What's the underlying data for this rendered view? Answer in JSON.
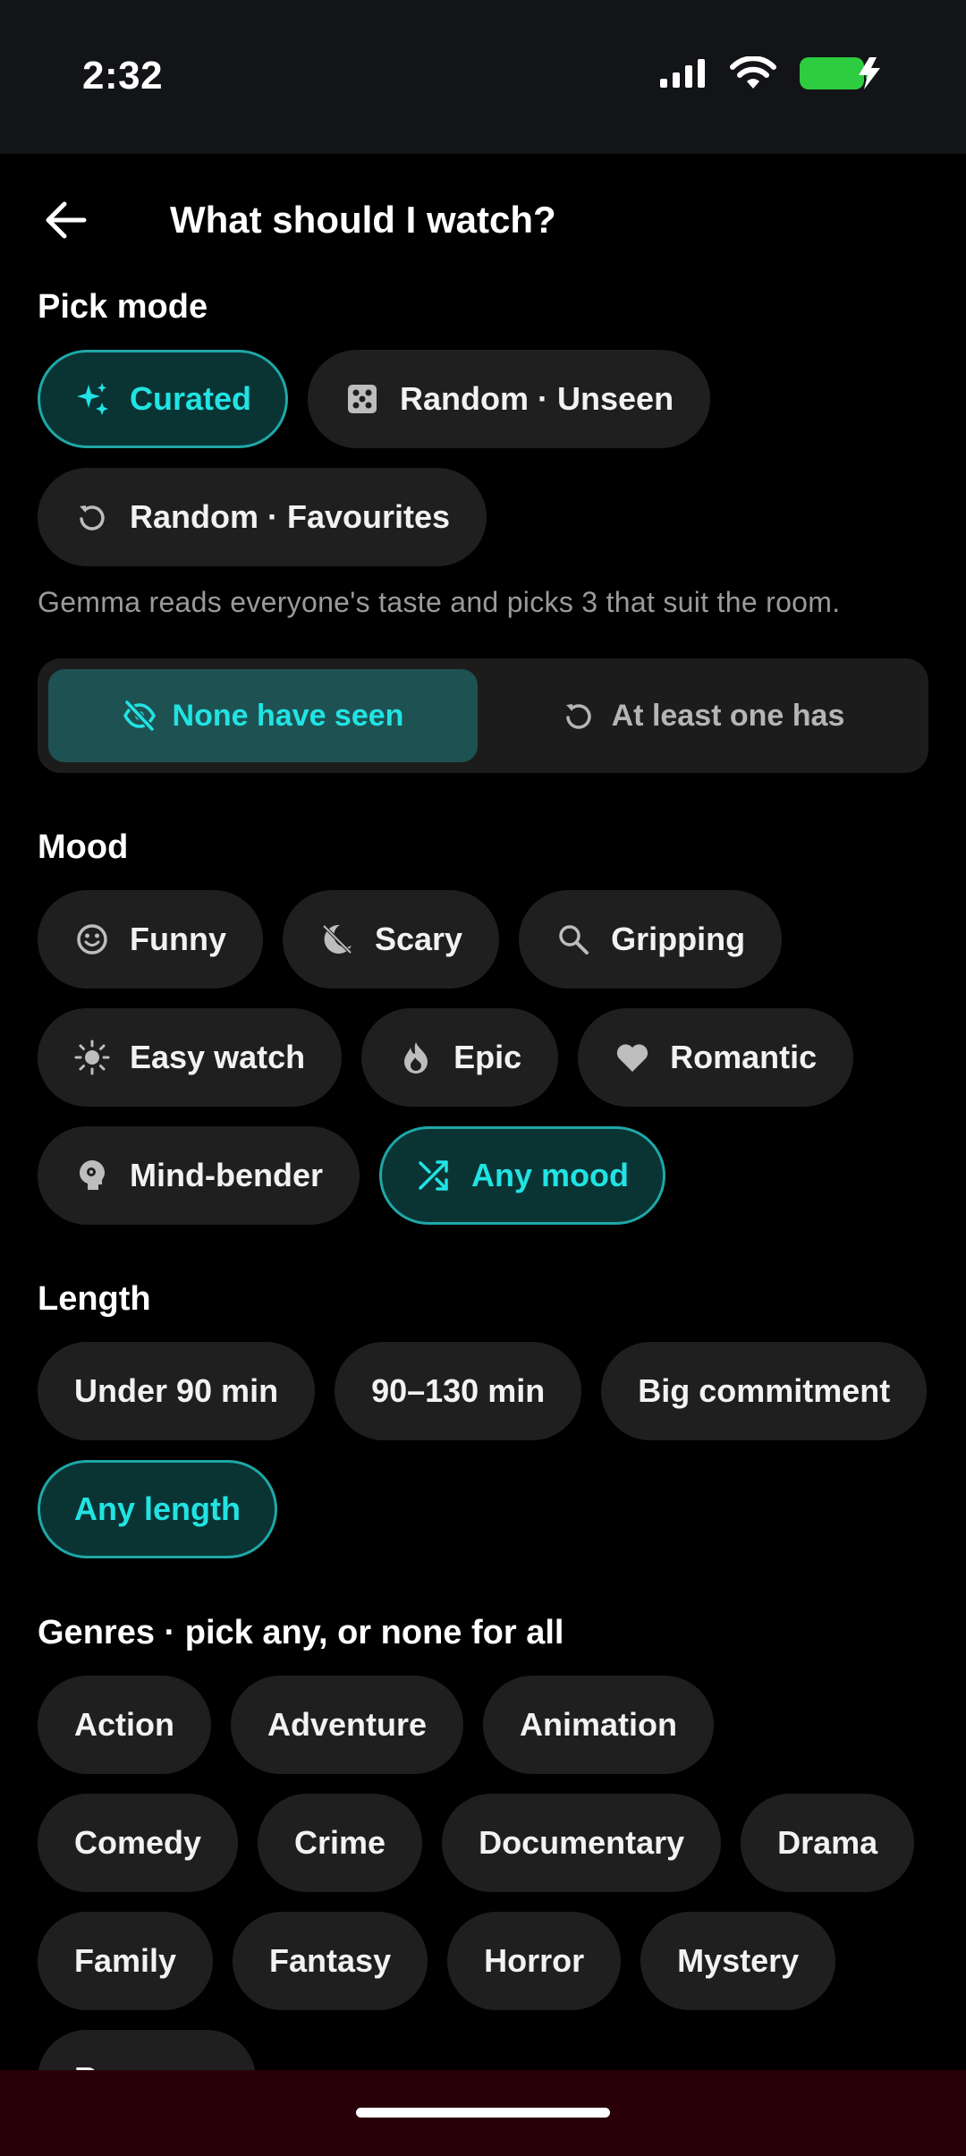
{
  "status_bar": {
    "time": "2:32"
  },
  "header": {
    "title": "What should I watch?"
  },
  "pick_mode": {
    "title": "Pick mode",
    "options": [
      {
        "label": "Curated",
        "icon": "sparkles-icon",
        "selected": true
      },
      {
        "label": "Random · Unseen",
        "icon": "dice-icon",
        "selected": false
      },
      {
        "label": "Random · Favourites",
        "icon": "replay-icon",
        "selected": false
      }
    ],
    "helper": "Gemma reads everyone's taste and picks 3 that suit the room."
  },
  "seen_filter": {
    "options": [
      {
        "label": "None have seen",
        "icon": "eye-off-icon",
        "active": true
      },
      {
        "label": "At least one has",
        "icon": "replay-icon",
        "active": false
      }
    ]
  },
  "mood": {
    "title": "Mood",
    "options": [
      {
        "label": "Funny",
        "icon": "smile-icon",
        "selected": false
      },
      {
        "label": "Scary",
        "icon": "moon-icon",
        "selected": false
      },
      {
        "label": "Gripping",
        "icon": "search-icon",
        "selected": false
      },
      {
        "label": "Easy watch",
        "icon": "sun-icon",
        "selected": false
      },
      {
        "label": "Epic",
        "icon": "flame-icon",
        "selected": false
      },
      {
        "label": "Romantic",
        "icon": "heart-icon",
        "selected": false
      },
      {
        "label": "Mind-bender",
        "icon": "brain-icon",
        "selected": false
      },
      {
        "label": "Any mood",
        "icon": "shuffle-icon",
        "selected": true
      }
    ]
  },
  "length": {
    "title": "Length",
    "options": [
      {
        "label": "Under 90 min",
        "selected": false
      },
      {
        "label": "90–130 min",
        "selected": false
      },
      {
        "label": "Big commitment",
        "selected": false
      },
      {
        "label": "Any length",
        "selected": true
      }
    ]
  },
  "genres": {
    "title": "Genres · pick any, or none for all",
    "options": [
      "Action",
      "Adventure",
      "Animation",
      "Comedy",
      "Crime",
      "Documentary",
      "Drama",
      "Family",
      "Fantasy",
      "Horror",
      "Mystery",
      "Romance"
    ]
  },
  "colors": {
    "accent": "#22e3e3",
    "chip_bg": "#1f1f1f",
    "selected_bg": "#0a3434",
    "selected_border": "#1fa7a7"
  }
}
